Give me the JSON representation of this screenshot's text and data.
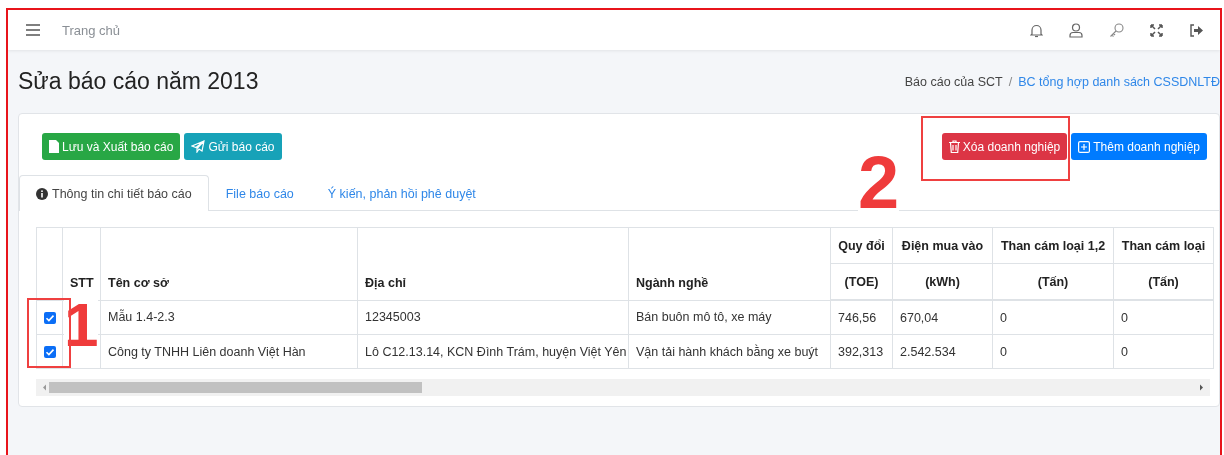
{
  "top_bar": {
    "home_link": "Trang chủ"
  },
  "page": {
    "title": "Sửa báo cáo năm 2013",
    "separator": "/",
    "breadcrumb": [
      {
        "label": "Báo cáo của SCT",
        "link": false
      },
      {
        "label": "BC tổng hợp danh sách CSSDNLTĐ",
        "link": true
      }
    ]
  },
  "left_buttons": [
    {
      "label": "Lưu và Xuất báo cáo",
      "kind": "success"
    },
    {
      "label": "Gửi báo cáo",
      "kind": "info"
    }
  ],
  "right_buttons": [
    {
      "label": "Xóa doanh nghiệp",
      "kind": "danger"
    },
    {
      "label": "Thêm doanh nghiệp",
      "kind": "primary"
    }
  ],
  "tabs": [
    {
      "label": "Thông tin chi tiết báo cáo",
      "selected": true
    },
    {
      "label": "File báo cáo",
      "selected": false
    },
    {
      "label": "Ý kiến, phản hồi phê duyệt",
      "selected": false
    }
  ],
  "table": {
    "columns": [
      {
        "title": "STT"
      },
      {
        "title": "Tên cơ sở"
      },
      {
        "title": "Địa chỉ"
      },
      {
        "title": "Ngành nghề"
      },
      {
        "title": "Quy đổi",
        "unit": "(TOE)"
      },
      {
        "title": "Điện mua vào",
        "unit": "(kWh)"
      },
      {
        "title": "Than cám loại 1,2",
        "unit": "(Tấn)"
      },
      {
        "title": "Than cám loại",
        "unit": "(Tấn)"
      }
    ],
    "rows": [
      {
        "checked": true,
        "cells": [
          "",
          "Mẫu 1.4-2.3",
          "12345003",
          "Bán buôn mô tô, xe máy",
          "746,56",
          "670,04",
          "0",
          "0"
        ]
      },
      {
        "checked": true,
        "cells": [
          "",
          "Công ty TNHH Liên doanh Việt Hàn",
          "Lô C12.13.14, KCN Đình Trám, huyện Việt Yên",
          "Vận tải hành khách bằng xe buýt",
          "392,313",
          "2.542.534",
          "0",
          "0"
        ]
      }
    ]
  },
  "annotations": [
    {
      "label": "1"
    },
    {
      "label": "2"
    }
  ]
}
